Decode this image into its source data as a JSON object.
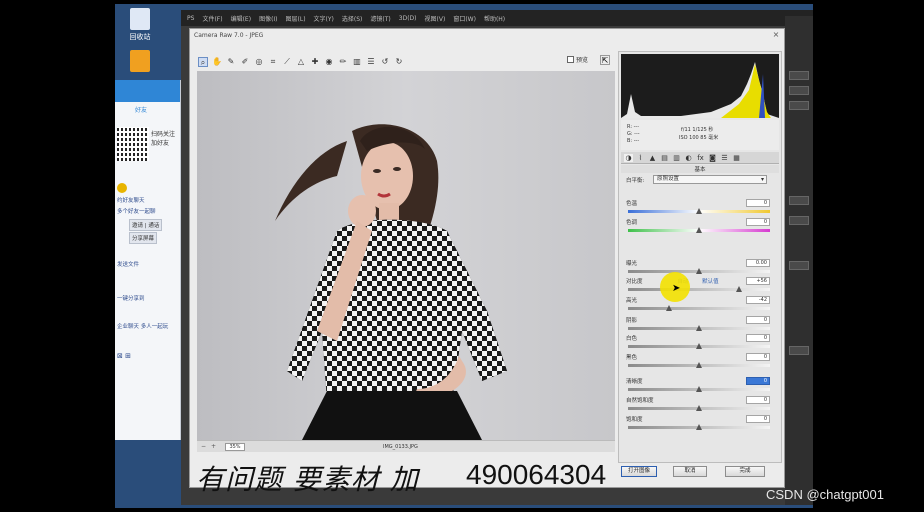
{
  "desktop": {
    "icons": [
      {
        "label": "回收站"
      },
      {
        "label": ""
      }
    ]
  },
  "chat": {
    "tab": "好友",
    "qr_text": "扫码关注 加好友",
    "lines": [
      "约好友聊天",
      "多个好友一起聊",
      "多人 | 通话",
      "分享屏幕",
      "发送文件",
      "一键分享到",
      "企业聊天 多人一起玩",
      "⊠ ⊞"
    ],
    "buttons": [
      "邀请 | 通话",
      "分享屏幕"
    ]
  },
  "ps": {
    "menu": [
      "PS",
      "文件(F)",
      "编辑(E)",
      "图像(I)",
      "图层(L)",
      "文字(Y)",
      "选择(S)",
      "滤镜(T)",
      "3D(D)",
      "视图(V)",
      "窗口(W)",
      "帮助(H)"
    ]
  },
  "acr": {
    "title": "Camera Raw 7.0 - JPEG",
    "preview_label": "预览",
    "zoom": "35%",
    "filename": "IMG_0133.JPG",
    "readout": {
      "r": "R: ---",
      "g": "G: ---",
      "b": "B: ---",
      "exif1": "f/11  1/125 秒",
      "exif2": "ISO 100  85 毫米"
    },
    "panel_title": "基本",
    "white_balance_label": "白平衡:",
    "white_balance_value": "原照设置",
    "auto_link": "自动",
    "default_link": "默认值",
    "controls": [
      {
        "label": "色温",
        "value": "0",
        "pos": 0.5
      },
      {
        "label": "色调",
        "value": "0",
        "pos": 0.5
      },
      {
        "label": "曝光",
        "value": "0.00",
        "pos": 0.5
      },
      {
        "label": "对比度",
        "value": "+56",
        "pos": 0.78
      },
      {
        "label": "高光",
        "value": "-42",
        "pos": 0.29
      },
      {
        "label": "阴影",
        "value": "0",
        "pos": 0.5
      },
      {
        "label": "白色",
        "value": "0",
        "pos": 0.5
      },
      {
        "label": "黑色",
        "value": "0",
        "pos": 0.5
      },
      {
        "label": "清晰度",
        "value": "0",
        "pos": 0.5,
        "selected": true
      },
      {
        "label": "自然饱和度",
        "value": "0",
        "pos": 0.5
      },
      {
        "label": "饱和度",
        "value": "0",
        "pos": 0.5
      }
    ],
    "buttons": {
      "open": "打开图像",
      "cancel": "取消",
      "done": "完成"
    }
  },
  "overlay": {
    "text": "有问题 要素材 加",
    "number": "490064304"
  },
  "watermark": "CSDN @chatgpt001",
  "colors": {
    "accent": "#3b78d6",
    "highlight": "#f3e100"
  }
}
